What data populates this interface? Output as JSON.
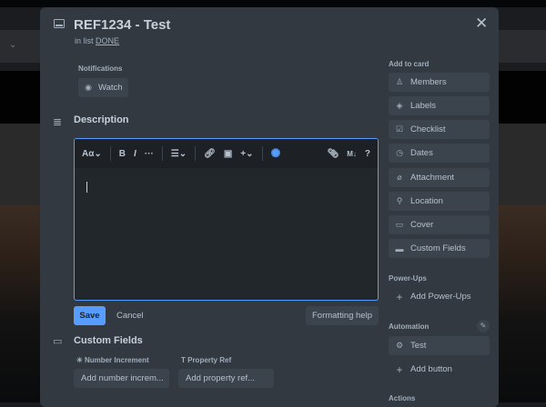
{
  "card": {
    "title": "REF1234 - Test",
    "in_list_prefix": "in list",
    "list_name": "DONE"
  },
  "notifications": {
    "label": "Notifications",
    "watch_label": "Watch"
  },
  "description": {
    "heading": "Description",
    "toolbar": {
      "text_style": "Aα",
      "bold": "B",
      "italic": "I",
      "more": "···",
      "help": "?",
      "markdown": "M↓"
    },
    "save_label": "Save",
    "cancel_label": "Cancel",
    "formatting_help_label": "Formatting help"
  },
  "custom_fields": {
    "heading": "Custom Fields",
    "fields": [
      {
        "label": "Number Increment",
        "placeholder": "Add number increm..."
      },
      {
        "label": "Property Ref",
        "placeholder": "Add property ref..."
      }
    ]
  },
  "sidebar": {
    "add_to_card_label": "Add to card",
    "add_to_card": [
      {
        "label": "Members",
        "icon": "person-icon"
      },
      {
        "label": "Labels",
        "icon": "tag-icon"
      },
      {
        "label": "Checklist",
        "icon": "checklist-icon"
      },
      {
        "label": "Dates",
        "icon": "clock-icon"
      },
      {
        "label": "Attachment",
        "icon": "paperclip-icon"
      },
      {
        "label": "Location",
        "icon": "pin-icon"
      },
      {
        "label": "Cover",
        "icon": "cover-icon"
      },
      {
        "label": "Custom Fields",
        "icon": "folder-icon"
      }
    ],
    "powerups_label": "Power-Ups",
    "add_powerups_label": "Add Power-Ups",
    "automation_label": "Automation",
    "automation_buttons": [
      {
        "label": "Test"
      }
    ],
    "add_button_label": "Add button",
    "actions_label": "Actions"
  },
  "colors": {
    "accent": "#579dff",
    "modal_bg": "#323940",
    "button_bg": "#3b434c"
  }
}
